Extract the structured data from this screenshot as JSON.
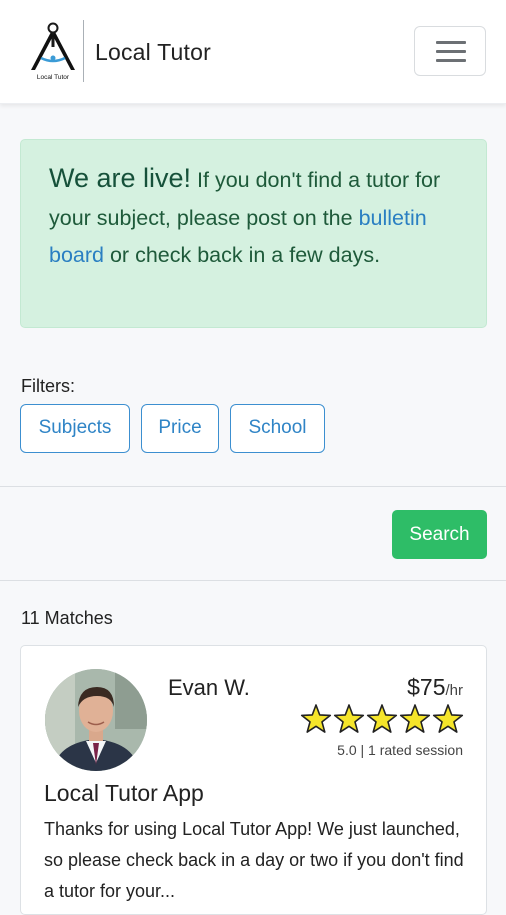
{
  "header": {
    "logo_caption": "Local Tutor",
    "brand_name": "Local Tutor",
    "menu_icon": "hamburger-menu-icon"
  },
  "alert": {
    "strong": "We are live!",
    "text_before_link": " If you don't find a tutor for your subject, please post on the ",
    "link": "bulletin board",
    "text_after_link": " or check back in a few days."
  },
  "filters": {
    "label": "Filters:",
    "buttons": [
      "Subjects",
      "Price",
      "School"
    ]
  },
  "search": {
    "label": "Search"
  },
  "results": {
    "count_label": "11 Matches",
    "cards": [
      {
        "name": "Evan W.",
        "price": "$75",
        "unit": "/hr",
        "stars": 5,
        "rating_text": "5.0 | 1 rated session",
        "title": "Local Tutor App",
        "description": "Thanks for using Local Tutor App! We just launched, so please check back in a day or two if you don't find a tutor for your..."
      }
    ]
  },
  "colors": {
    "alert_bg": "#d5f1e0",
    "link": "#2a7fc2",
    "filter_border": "#3c8fd0",
    "search_bg": "#2ebd67",
    "star": "#f5e52a"
  }
}
